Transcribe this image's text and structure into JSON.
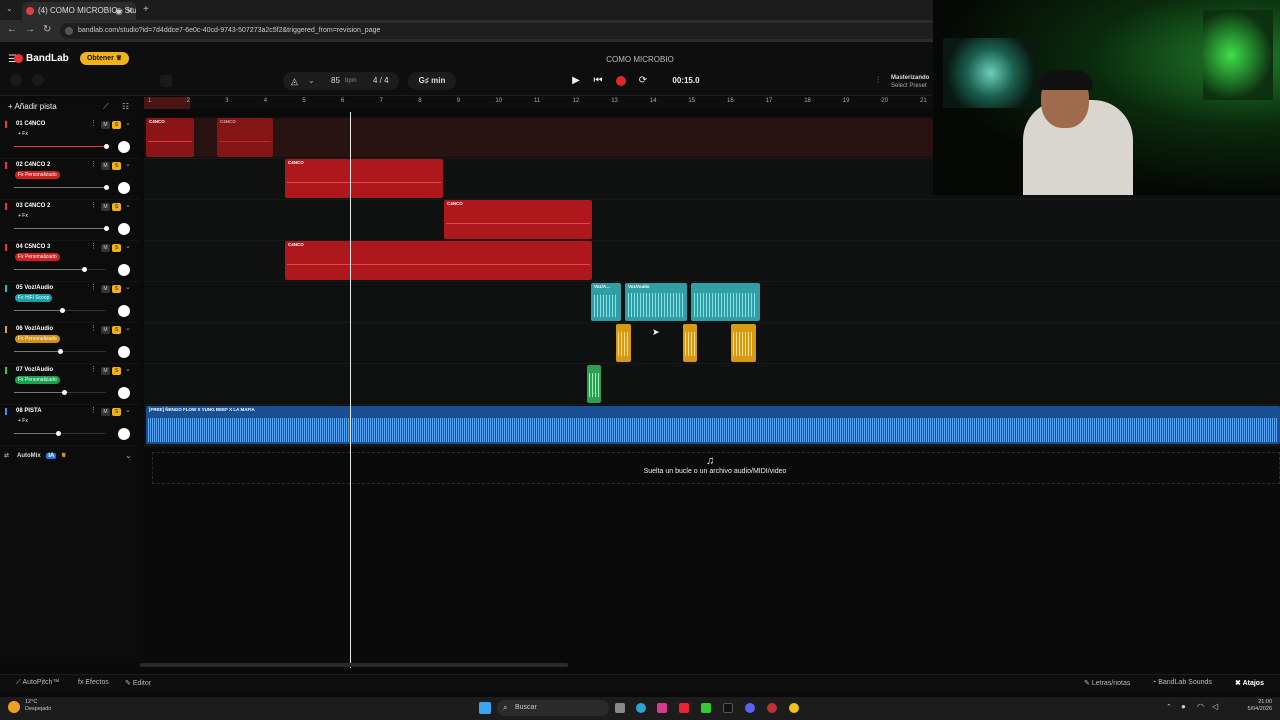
{
  "browser": {
    "tab_title": "(4) COMO MICROBIO - Stu",
    "url": "bandlab.com/studio?id=7d4ddce7-6e0c-40cd-9743-507273a2c5f2&triggered_from=revision_page"
  },
  "app": {
    "logo": "BandLab",
    "get_button": "Obtener",
    "project_title": "COMO MICROBIO",
    "tempo": "85",
    "tempo_unit": "bpm",
    "time_signature": "4 / 4",
    "key": "G♯ min",
    "time": "00:15.0",
    "master_title": "Masterizando",
    "master_sub": "Select Preset",
    "add_track": "Añadir pista"
  },
  "ruler": [
    "1",
    "2",
    "3",
    "4",
    "5",
    "6",
    "7",
    "8",
    "9",
    "10",
    "11",
    "12",
    "13",
    "14",
    "15",
    "16",
    "17",
    "18",
    "19",
    "20",
    "21"
  ],
  "tracks": [
    {
      "name": "01  C4NCO",
      "fx": "+ Fx",
      "fx_color": "",
      "num_color": "#e33"
    },
    {
      "name": "02  C4NCO 2",
      "fx": "Fx Personalizado",
      "fx_color": "#c22",
      "num_color": "#e33"
    },
    {
      "name": "03  C4NCO 2",
      "fx": "+ Fx",
      "fx_color": "",
      "num_color": "#e33"
    },
    {
      "name": "04  C5NCO 3",
      "fx": "Fx Personalizado",
      "fx_color": "#c22",
      "num_color": "#e33"
    },
    {
      "name": "05  Voz/Audio",
      "fx": "Fx HiFi Scoop",
      "fx_color": "#1aa0a8",
      "num_color": "#2bc"
    },
    {
      "name": "06  Voz/Audio",
      "fx": "Fx Personalizado",
      "fx_color": "#d09010",
      "num_color": "#f0a010"
    },
    {
      "name": "07  Voz/Audio",
      "fx": "Fx Personalizado",
      "fx_color": "#1ba050",
      "num_color": "#2c6"
    },
    {
      "name": "08  PISTA",
      "fx": "+ Fx",
      "fx_color": "",
      "num_color": "#48f"
    }
  ],
  "mute_label": "M",
  "solo_label": "S",
  "clips": {
    "c1a": "C4NCO",
    "c1b": "C4NCO",
    "c2": "C4NCO",
    "c3": "C4NCO",
    "c4": "C4NCO",
    "v1": "Voz/A...",
    "v2": "Voz/Audio",
    "pista": "[FREE] ÑENGO FLOW X YUNG BEEF X LA MAFIA"
  },
  "automix": {
    "label": "AutoMix",
    "badge": "IA"
  },
  "drop_text": "Suelta un bucle o un archivo audio/MIDI/video",
  "bottom": {
    "autopitch": "AutoPitch™",
    "effects": "Efectos",
    "editor": "Editor",
    "lyrics": "Letras/notas",
    "sounds": "BandLab Sounds",
    "shortcuts": "Atajos"
  },
  "taskbar": {
    "weather_temp": "12°C",
    "weather_desc": "Despejado",
    "search": "Buscar",
    "clock_time": "21:00",
    "clock_date": "5/04/2026"
  },
  "colors": {
    "accent": "#f2b31a",
    "red_clip": "#b3181c",
    "teal_clip": "#3ab8bd",
    "gold_clip": "#e0a418",
    "green_clip": "#36b060",
    "blue_clip": "#3d86d8"
  }
}
